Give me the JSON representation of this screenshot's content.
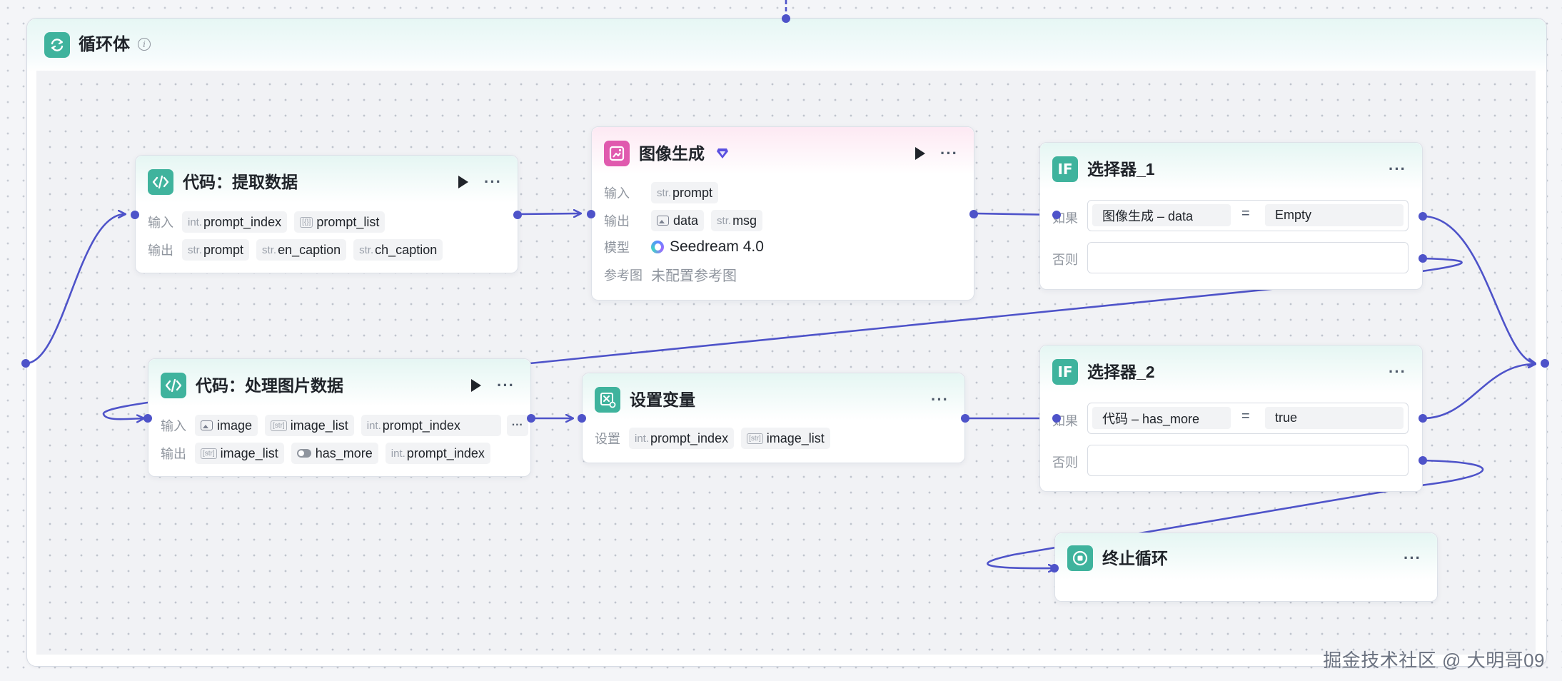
{
  "loop": {
    "title": "循环体",
    "icon": "loop-icon"
  },
  "labels": {
    "input": "输入",
    "output": "输出",
    "model": "模型",
    "ref": "参考图",
    "set": "设置",
    "if": "如果",
    "else": "否则"
  },
  "type_labels": {
    "int": "int.",
    "str": "str.",
    "list_obj": "[{}]",
    "list_str": "[str]"
  },
  "nodes": {
    "extract": {
      "title": "代码：提取数据",
      "inputs": [
        "prompt_index",
        "prompt_list"
      ],
      "outputs": [
        "prompt",
        "en_caption",
        "ch_caption"
      ]
    },
    "imagegen": {
      "title": "图像生成",
      "inputs": [
        "prompt"
      ],
      "outputs": [
        "data",
        "msg"
      ],
      "model": "Seedream 4.0",
      "ref": "未配置参考图"
    },
    "selector1": {
      "title": "选择器_1",
      "cond_left": "图像生成 – data",
      "cond_op": "=",
      "cond_right": "Empty"
    },
    "process": {
      "title": "代码：处理图片数据",
      "inputs": [
        "image",
        "image_list",
        "prompt_index"
      ],
      "outputs": [
        "image_list",
        "has_more",
        "prompt_index"
      ],
      "more": "···"
    },
    "setvar": {
      "title": "设置变量",
      "items": [
        "prompt_index",
        "image_list"
      ]
    },
    "selector2": {
      "title": "选择器_2",
      "cond_left": "代码 – has_more",
      "cond_op": "=",
      "cond_right": "true"
    },
    "stop": {
      "title": "终止循环"
    }
  },
  "controls": {
    "more": "···"
  },
  "watermark": "掘金技术社区 @ 大明哥09",
  "colors": {
    "accent": "#3fb39d",
    "pink": "#e05aae",
    "wire": "#4e53c9"
  }
}
